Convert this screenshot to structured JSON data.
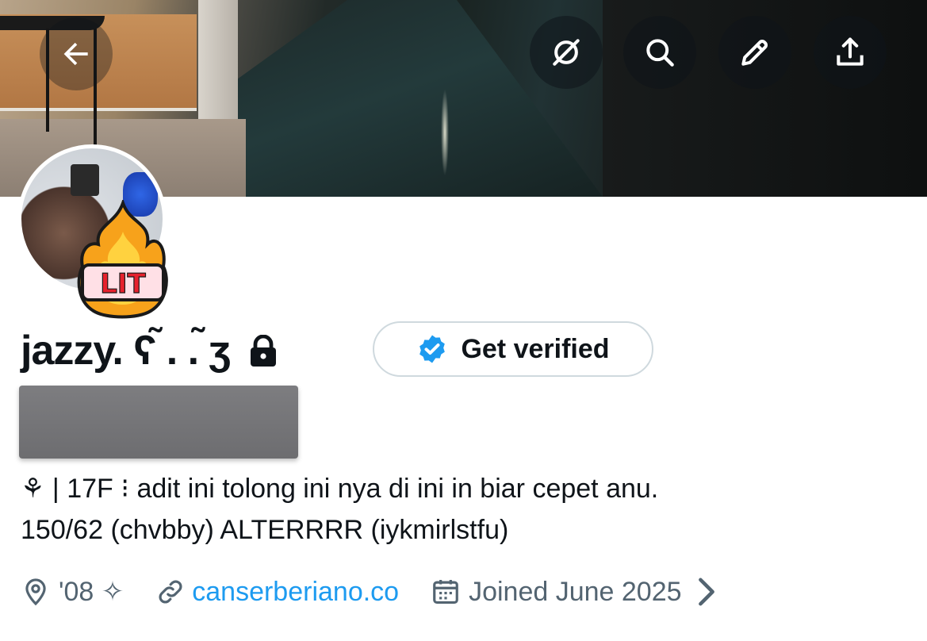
{
  "header": {
    "back_icon": "arrow-left-icon",
    "actions": [
      {
        "name": "grok-icon"
      },
      {
        "name": "search-icon"
      },
      {
        "name": "edit-icon"
      },
      {
        "name": "share-icon"
      }
    ]
  },
  "avatar": {
    "sticker_text": "LIT"
  },
  "profile": {
    "display_name": "jazzy. ૮ ˶ᵔ ᵕ ᵔ˶ ა",
    "display_name_shown": "jazzy. ʕ ̃. . ̃ʒ",
    "verify_label": "Get verified",
    "bio_line1": "⚘  |  17F ⁝ adit ini tolong ini nya di ini in biar cepet anu.",
    "bio_line2": "150/62 (chvbby) ALTERRRR (iykmirlstfu)",
    "location": "'08 ✧",
    "website": "canserberiano.co",
    "joined": "Joined June 2025"
  },
  "colors": {
    "link": "#1d9bf0",
    "muted": "#536471",
    "text": "#0f1419",
    "verified_badge": "#1d9bf0"
  }
}
